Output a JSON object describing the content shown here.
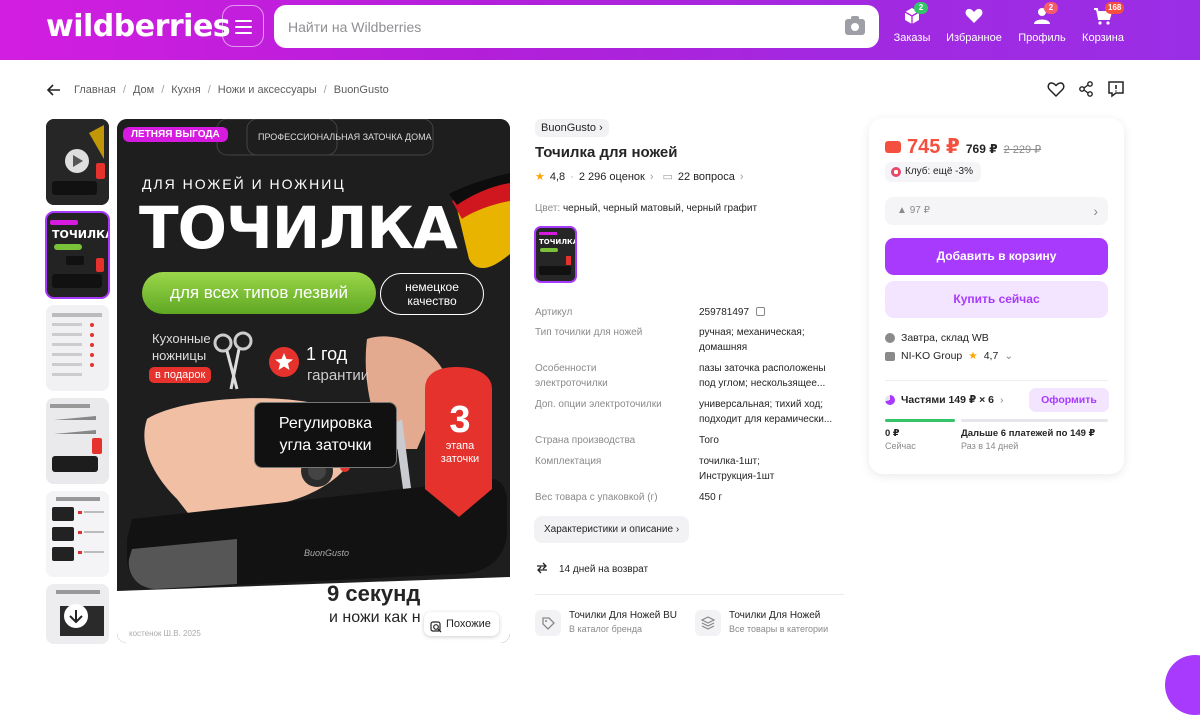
{
  "header": {
    "logo": "wildberries",
    "search_placeholder": "Найти на Wildberries",
    "nav": [
      {
        "label": "Заказы",
        "badge": "2",
        "icon": "box-icon"
      },
      {
        "label": "Избранное",
        "badge": "",
        "icon": "heart-icon"
      },
      {
        "label": "Профиль",
        "badge": "2",
        "icon": "user-icon"
      },
      {
        "label": "Корзина",
        "badge": "168",
        "icon": "cart-icon"
      }
    ]
  },
  "breadcrumbs": [
    "Главная",
    "Дом",
    "Кухня",
    "Ножи и аксессуары",
    "BuonGusto"
  ],
  "main_image": {
    "promo_badge": "ЛЕТНЯЯ ВЫГОДА",
    "promo_sub": "ПРОФЕССИОНАЛЬНАЯ ЗАТОЧКА ДОМА",
    "headline_small": "ДЛЯ НОЖЕЙ И НОЖНИЦ",
    "headline": "ТОЧИЛКА",
    "green_pill": "для всех типов лезвий",
    "quality_pill_1": "немецкое",
    "quality_pill_2": "качество",
    "scissors_1": "Кухонные",
    "scissors_2": "ножницы",
    "gift": "в подарок",
    "warranty_1": "1 год",
    "warranty_2": "гарантии",
    "angle_1": "Регулировка",
    "angle_2": "угла заточки",
    "stages_num": "3",
    "stages_1": "этапа",
    "stages_2": "заточки",
    "bottom_1": "9 секунд",
    "bottom_2": "и ножи как н",
    "similar_button": "Похожие",
    "device_brand": "BuonGusto",
    "footer_faded": "костенок Ш.В. 2025"
  },
  "product": {
    "brand": "BuonGusto",
    "title": "Точилка для ножей",
    "rating": "4,8",
    "reviews": "2 296 оценок",
    "questions": "22 вопроса",
    "color_label": "Цвет:",
    "color_value": "черный, черный матовый, черный графит",
    "specs": [
      {
        "k": "Артикул",
        "v": "259781497"
      },
      {
        "k": "Тип точилки для ножей",
        "v": "ручная; механическая; домашняя"
      },
      {
        "k": "Особенности электроточилки",
        "v": "пазы заточка расположены под углом; нескользящее..."
      },
      {
        "k": "Доп. опции электроточилки",
        "v": "универсальная; тихий ход; подходит для керамически..."
      },
      {
        "k": "Страна производства",
        "v": "Того"
      },
      {
        "k": "Комплектация",
        "v": "точилка-1шт; Инструкция-1шт"
      },
      {
        "k": "Вес товара с упаковкой (г)",
        "v": "450 г"
      }
    ],
    "characteristics_button": "Характеристики и описание",
    "return_text": "14 дней на возврат",
    "categories": [
      {
        "title": "Точилки Для Ножей BU",
        "sub": "В каталог бренда"
      },
      {
        "title": "Точилки Для Ножей",
        "sub": "Все товары в категории"
      }
    ]
  },
  "buy_card": {
    "price": "745 ₽",
    "price_card": "769 ₽",
    "price_old": "2 229 ₽",
    "club": "Клуб: ещё -3%",
    "drop_price": "97 ₽",
    "add_to_cart": "Добавить в корзину",
    "buy_now": "Купить сейчас",
    "delivery": "Завтра, склад WB",
    "seller": "NI-KO Group",
    "seller_rating": "4,7",
    "installments": "Частями 149 ₽ × 6",
    "installments_button": "Оформить",
    "pay_now_amount": "0 ₽",
    "pay_now_label": "Сейчас",
    "pay_later_amount": "Дальше 6 платежей по 149 ₽",
    "pay_later_label": "Раз в 14 дней"
  }
}
